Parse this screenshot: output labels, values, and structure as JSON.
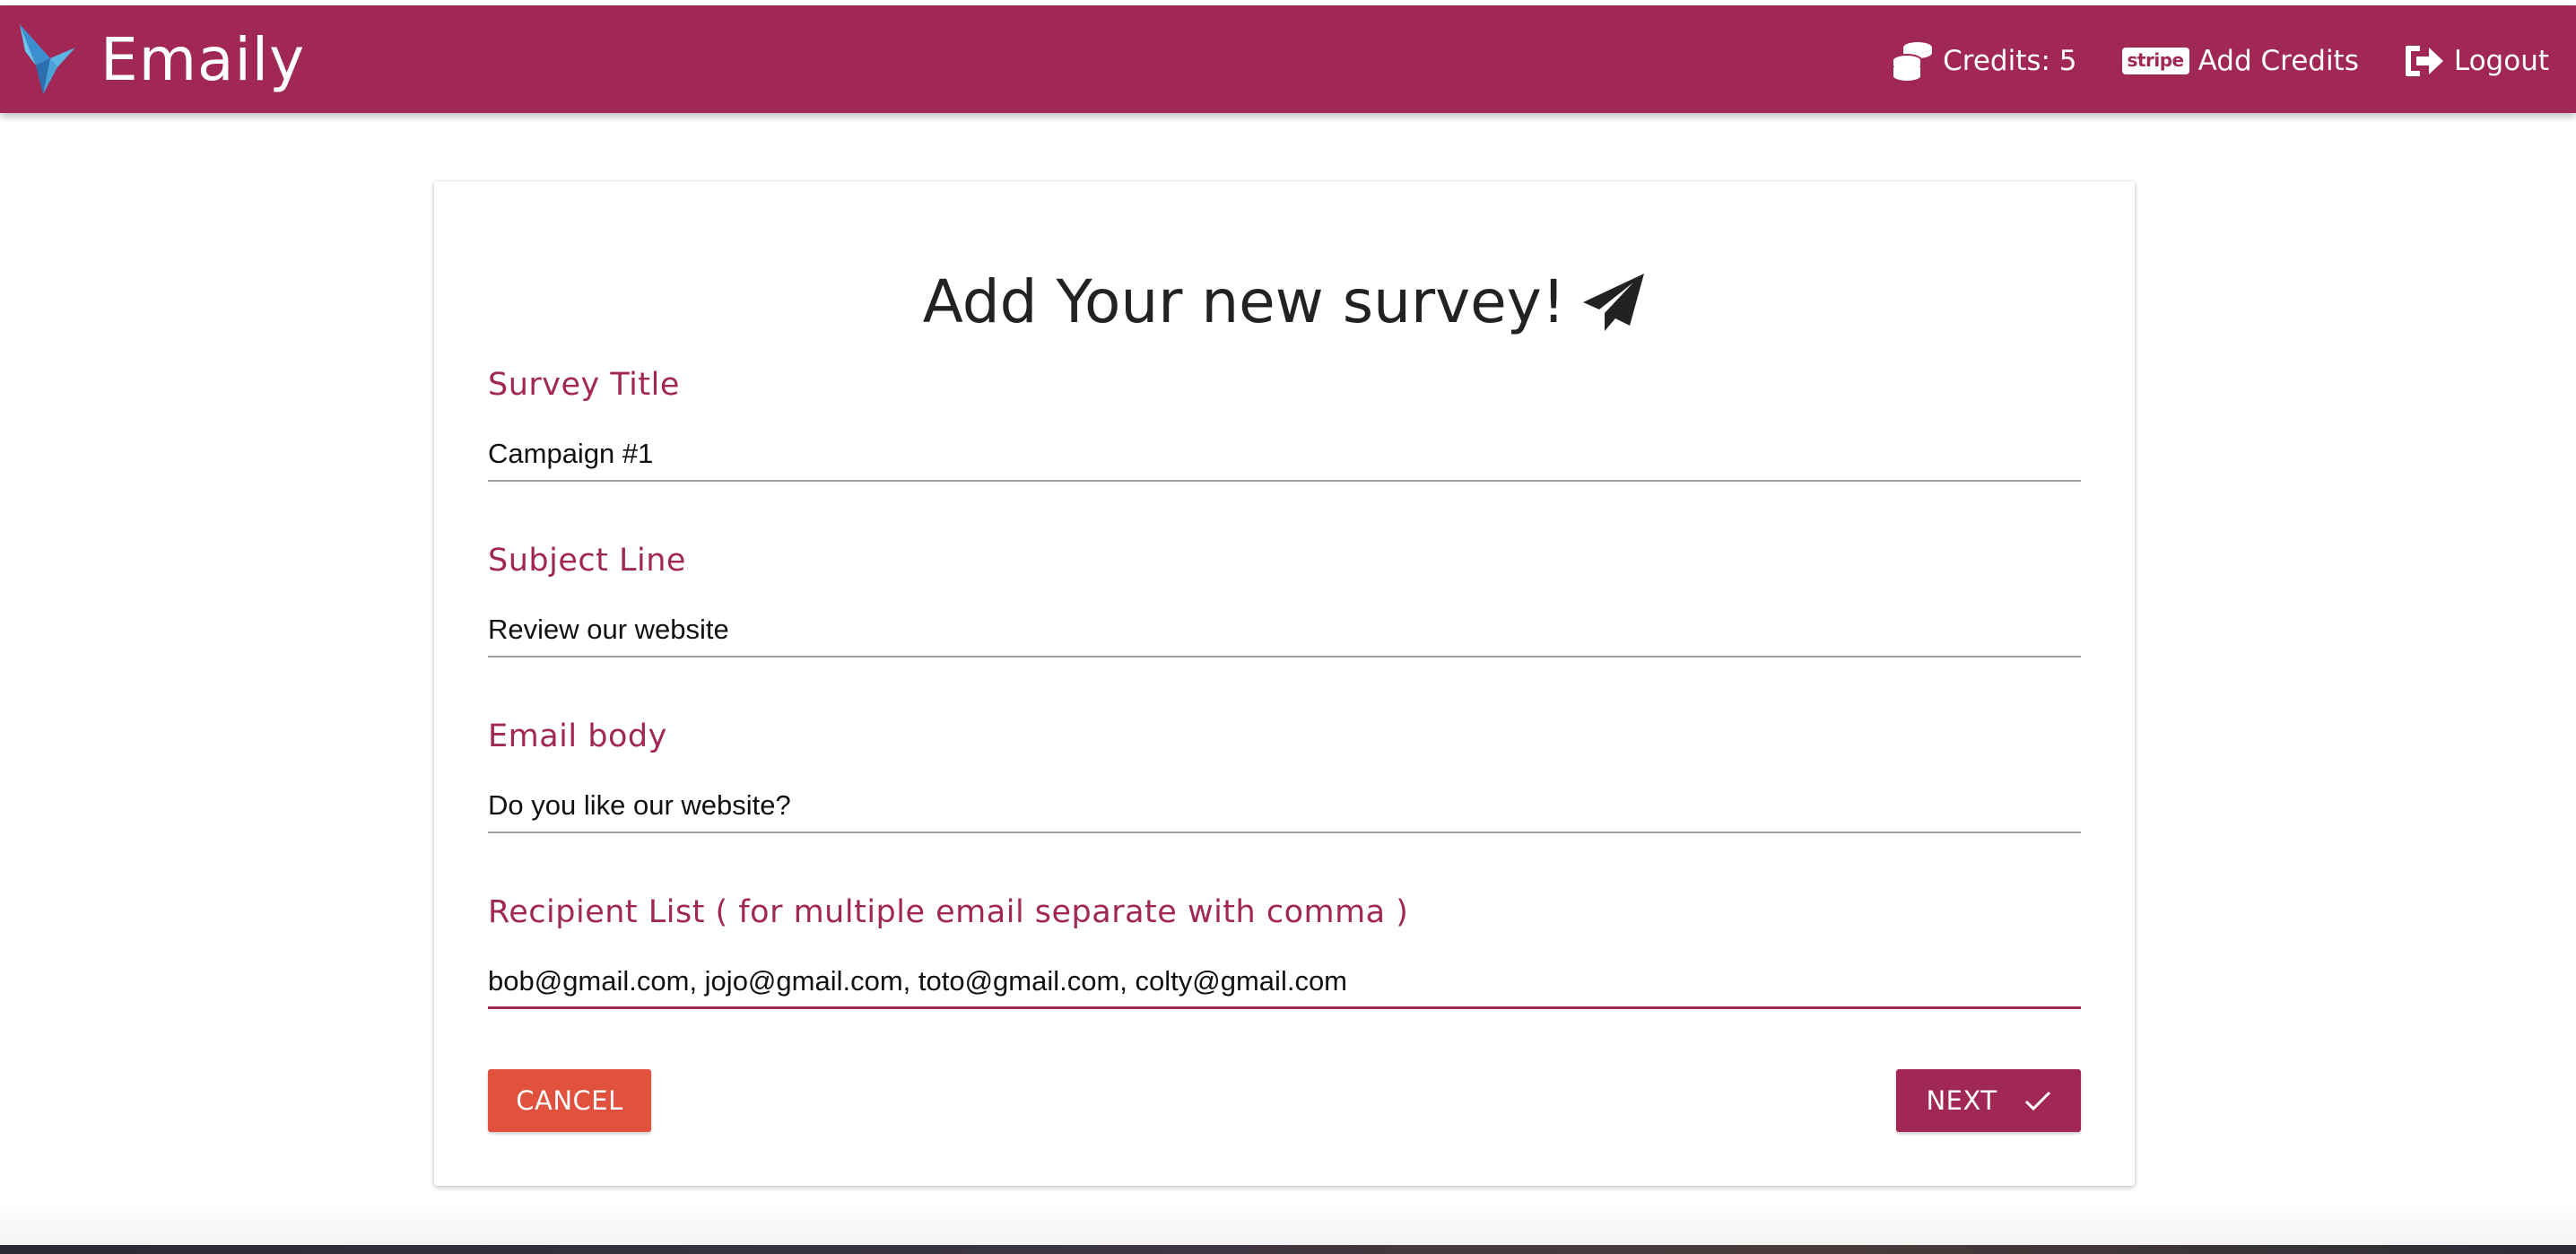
{
  "app": {
    "title": "Emaily"
  },
  "navbar": {
    "credits_label": "Credits: 5",
    "stripe_badge": "stripe",
    "add_credits_label": "Add Credits",
    "logout_label": "Logout",
    "icons": {
      "credits": "coins-icon",
      "add_credits": "stripe-icon",
      "logout": "sign-out-icon"
    },
    "background_color": "#a12755"
  },
  "form": {
    "title": "Add Your new survey!",
    "title_icon": "paper-plane-icon",
    "fields": [
      {
        "label": "Survey Title",
        "value": "Campaign #1"
      },
      {
        "label": "Subject Line",
        "value": "Review our website"
      },
      {
        "label": "Email body",
        "value": "Do you like our website?"
      },
      {
        "label": "Recipient List ( for multiple email separate with comma )",
        "value": "bob@gmail.com, jojo@gmail.com, toto@gmail.com, colty@gmail.com"
      }
    ],
    "cancel_label": "CANCEL",
    "next_label": "NEXT",
    "next_icon": "check-icon"
  },
  "colors": {
    "primary": "#a12755",
    "cancel": "#e0513e",
    "label": "#a12755"
  }
}
